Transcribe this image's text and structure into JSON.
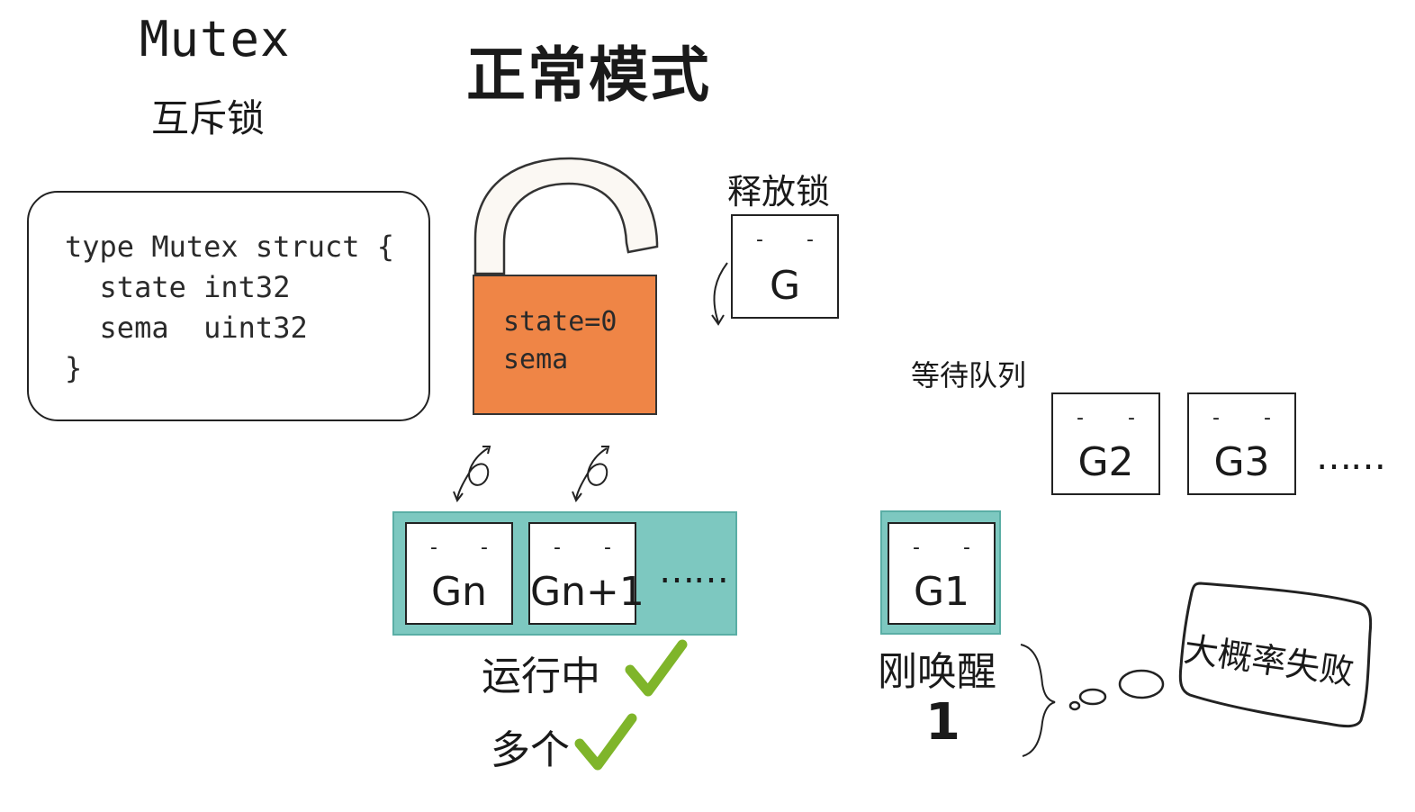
{
  "title": {
    "main": "Mutex",
    "sub": "互斥锁"
  },
  "mode_title": "正常模式",
  "code": {
    "lines": [
      "type Mutex struct {",
      "  state int32",
      "  sema  uint32",
      "}"
    ]
  },
  "lock": {
    "state_text": "state=0",
    "sema_text": "sema",
    "body_color": "#ef8546"
  },
  "release": {
    "label": "释放锁",
    "goroutine": "G"
  },
  "queue": {
    "label": "等待队列",
    "items": [
      "G2",
      "G3"
    ],
    "ellipsis": "……"
  },
  "running": {
    "items": [
      "Gn",
      "Gn+1"
    ],
    "ellipsis": "……",
    "label": "运行中",
    "multi_label": "多个",
    "highlight_color": "#7dc8c0"
  },
  "woken": {
    "goroutine": "G1",
    "label": "刚唤醒",
    "count": "1"
  },
  "thought": {
    "text": "大概率失败"
  },
  "colors": {
    "check": "#7fb52a",
    "teal": "#7dc8c0",
    "lock_orange": "#ef8546"
  },
  "icons": [
    "face-icon",
    "spin-arrow-icon",
    "checkmark-icon",
    "brace-icon",
    "thought-bubble-icon"
  ]
}
